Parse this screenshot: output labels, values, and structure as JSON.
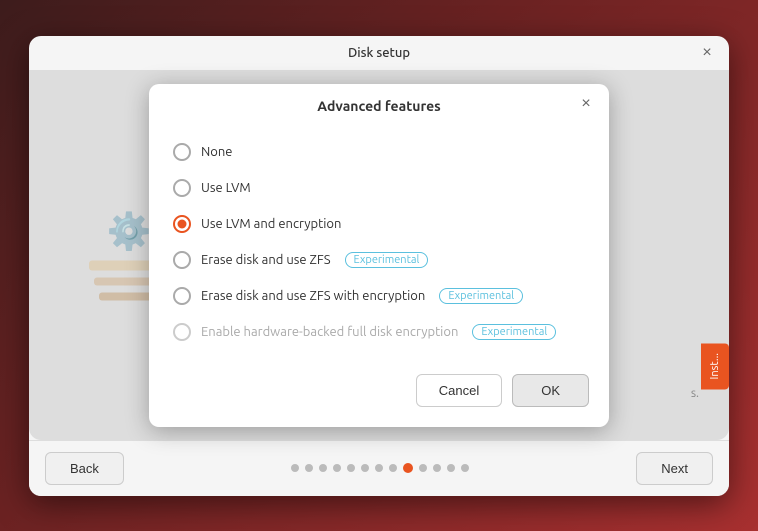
{
  "window": {
    "title": "Disk setup",
    "close_label": "×"
  },
  "modal": {
    "title": "Advanced features",
    "close_label": "×",
    "options": [
      {
        "id": "none",
        "label": "None",
        "checked": false,
        "disabled": false,
        "badge": null
      },
      {
        "id": "lvm",
        "label": "Use LVM",
        "checked": false,
        "disabled": false,
        "badge": null
      },
      {
        "id": "lvm-encryption",
        "label": "Use LVM and encryption",
        "checked": true,
        "disabled": false,
        "badge": null
      },
      {
        "id": "zfs",
        "label": "Erase disk and use ZFS",
        "checked": false,
        "disabled": false,
        "badge": "Experimental"
      },
      {
        "id": "zfs-encryption",
        "label": "Erase disk and use ZFS with encryption",
        "checked": false,
        "disabled": false,
        "badge": "Experimental"
      },
      {
        "id": "hardware-encryption",
        "label": "Enable hardware-backed full disk encryption",
        "checked": false,
        "disabled": true,
        "badge": "Experimental"
      }
    ],
    "cancel_label": "Cancel",
    "ok_label": "OK"
  },
  "footer": {
    "back_label": "Back",
    "next_label": "Next",
    "dots_count": 13,
    "active_dot": 8
  },
  "install_button": "Inst..."
}
